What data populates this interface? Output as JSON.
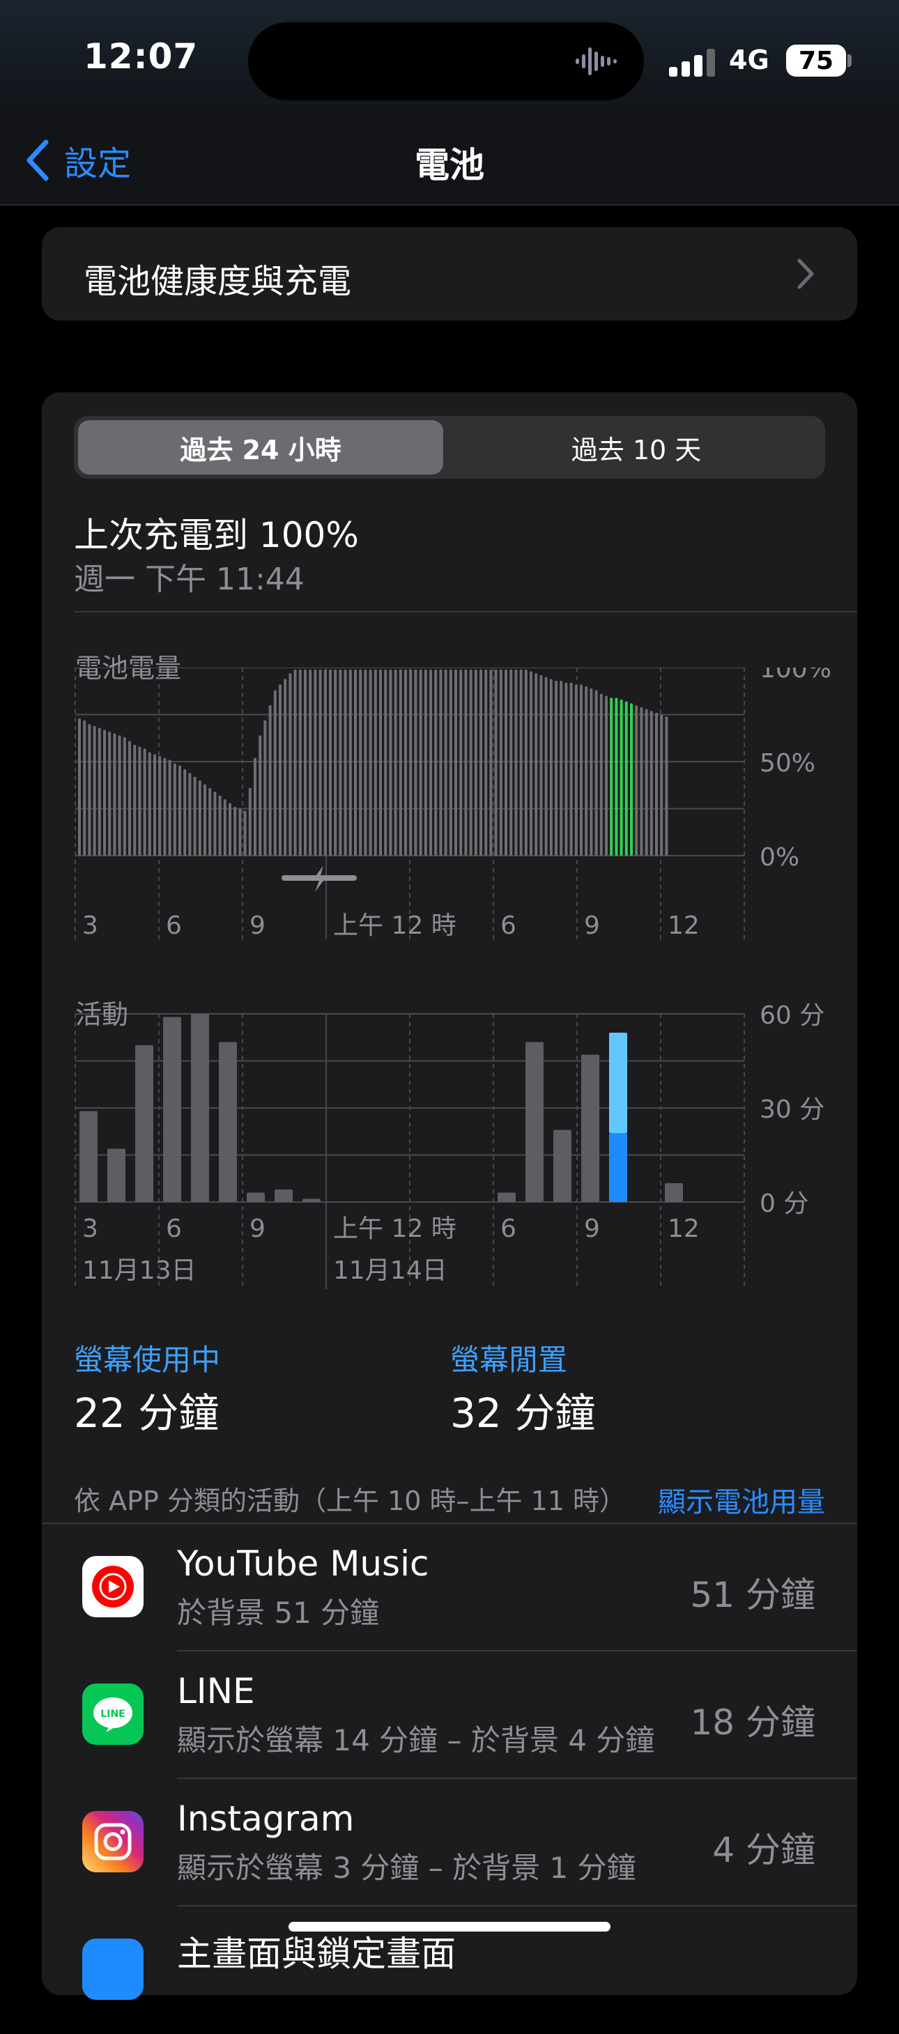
{
  "status_bar": {
    "time": "12:07",
    "network": "4G",
    "battery": "75"
  },
  "nav": {
    "back_label": "設定",
    "title": "電池"
  },
  "health": {
    "label": "電池健康度與充電"
  },
  "segmented": {
    "option_a": "過去 24 小時",
    "option_b": "過去 10 天",
    "selected": "option_a"
  },
  "last_charge": {
    "title": "上次充電到 100%",
    "time": "週一 下午 11:44"
  },
  "chart_data": [
    {
      "type": "bar",
      "title": "電池電量",
      "y_ticks": [
        "100%",
        "50%",
        "0%"
      ],
      "ylim": [
        0,
        100
      ],
      "x_ticks": [
        "3",
        "6",
        "9",
        "上午 12 時",
        "6",
        "9",
        "12"
      ],
      "values": [
        73,
        72,
        70,
        69,
        68,
        67,
        66,
        65,
        64,
        63,
        61,
        59,
        58,
        57,
        55,
        54,
        53,
        52,
        51,
        49,
        48,
        46,
        44,
        42,
        40,
        38,
        36,
        34,
        32,
        30,
        28,
        26,
        25,
        24,
        36,
        52,
        64,
        72,
        80,
        88,
        91,
        94,
        97,
        99,
        99,
        99,
        99,
        99,
        99,
        99,
        99,
        99,
        99,
        99,
        99,
        99,
        99,
        99,
        99,
        99,
        99,
        99,
        99,
        99,
        99,
        99,
        99,
        99,
        99,
        99,
        99,
        99,
        99,
        99,
        99,
        99,
        99,
        99,
        99,
        99,
        99,
        99,
        99,
        99,
        99,
        99,
        99,
        99,
        99,
        99,
        98,
        97,
        96,
        95,
        94,
        93,
        93,
        92,
        92,
        91,
        91,
        90,
        89,
        88,
        86,
        85,
        84,
        84,
        83,
        82,
        81,
        80,
        79,
        78,
        77,
        76,
        75,
        74
      ],
      "charging_interval": [
        7.5,
        10
      ],
      "highlight_color": "#30d158",
      "bar_color": "#6e6e73"
    },
    {
      "type": "bar",
      "title": "活動",
      "y_ticks": [
        "60 分",
        "30 分",
        "0 分"
      ],
      "ylim": [
        0,
        60
      ],
      "x_ticks": [
        "3",
        "6",
        "9",
        "上午 12 時",
        "6",
        "9",
        "12"
      ],
      "date_labels": [
        "11月13日",
        "11月14日"
      ],
      "series": [
        {
          "name": "螢幕使用中",
          "color": "#1e8bff",
          "values": [
            29,
            17,
            50,
            59,
            60,
            51,
            3,
            4,
            1,
            0,
            0,
            0,
            0,
            0,
            0,
            3,
            51,
            23,
            47,
            22,
            0,
            6
          ]
        },
        {
          "name": "螢幕閒置",
          "color": "#63c7ff",
          "values": [
            0,
            0,
            0,
            0,
            0,
            0,
            0,
            0,
            0,
            0,
            0,
            0,
            0,
            0,
            0,
            0,
            0,
            0,
            0,
            32,
            0,
            0
          ]
        }
      ],
      "highlight_index": 19
    }
  ],
  "stats": {
    "screen_on_label": "螢幕使用中",
    "screen_on_value": "22 分鐘",
    "screen_off_label": "螢幕閒置",
    "screen_off_value": "32 分鐘"
  },
  "apps_section": {
    "header": "依 APP 分類的活動（上午 10 時–上午 11 時）",
    "link": "顯示電池用量"
  },
  "apps": [
    {
      "name": "YouTube Music",
      "detail": "於背景 51 分鐘",
      "time": "51 分鐘",
      "icon": "youtube-music-icon"
    },
    {
      "name": "LINE",
      "detail": "顯示於螢幕 14 分鐘 – 於背景 4 分鐘",
      "time": "18 分鐘",
      "icon": "line-icon"
    },
    {
      "name": "Instagram",
      "detail": "顯示於螢幕 3 分鐘 – 於背景 1 分鐘",
      "time": "4 分鐘",
      "icon": "instagram-icon"
    },
    {
      "name": "主畫面與鎖定畫面",
      "detail": "",
      "time": "",
      "icon": "home-screen-icon"
    }
  ]
}
